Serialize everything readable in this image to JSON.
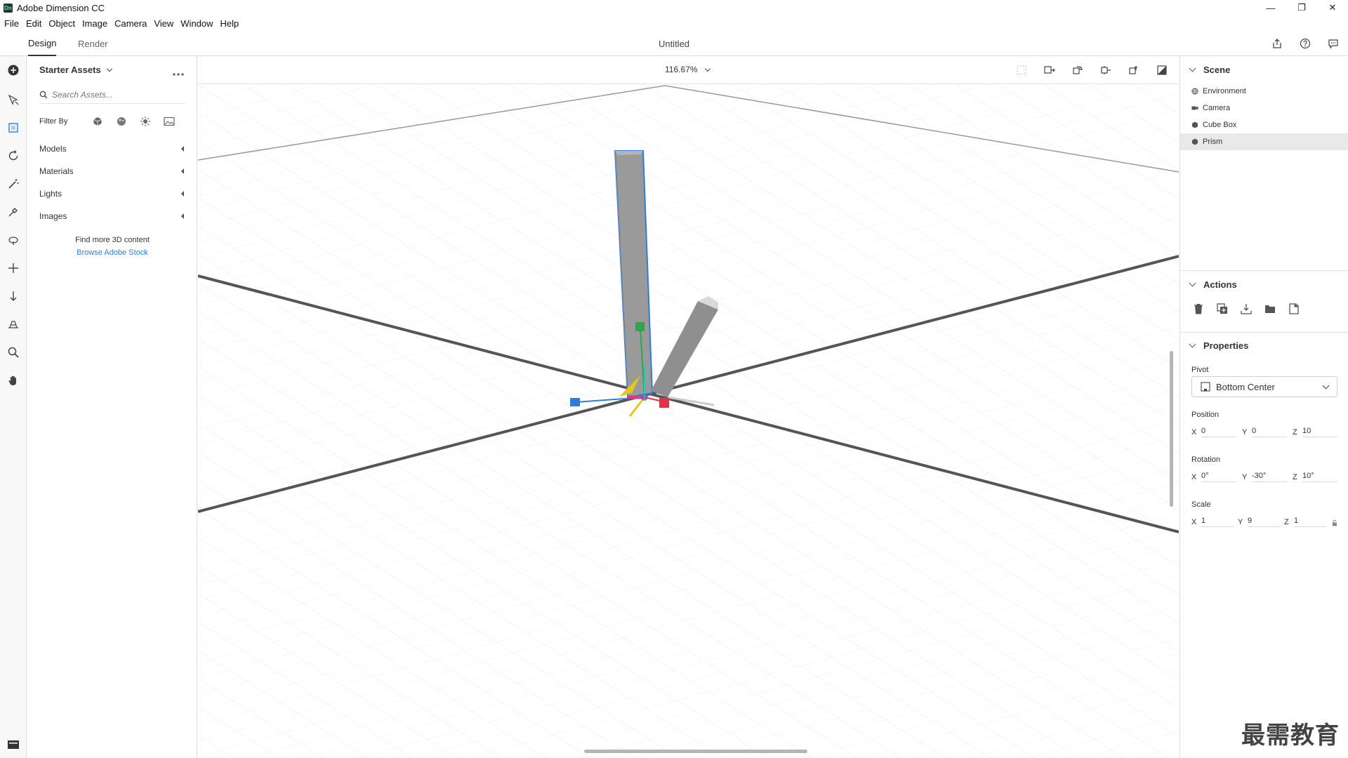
{
  "window": {
    "app_title": "Adobe Dimension CC",
    "app_icon_text": "Dn",
    "minimize": "—",
    "restore": "❐",
    "close": "✕"
  },
  "menu": [
    "File",
    "Edit",
    "Object",
    "Image",
    "Camera",
    "View",
    "Window",
    "Help"
  ],
  "workspace": {
    "tabs": [
      "Design",
      "Render"
    ],
    "active_tab": "Design",
    "doc_title": "Untitled"
  },
  "assets": {
    "header": "Starter Assets",
    "search_placeholder": "Search Assets...",
    "filter_label": "Filter By",
    "categories": [
      "Models",
      "Materials",
      "Lights",
      "Images"
    ],
    "more_text": "Find more 3D content",
    "more_link": "Browse Adobe Stock"
  },
  "viewport": {
    "zoom": "116.67%"
  },
  "scene": {
    "title": "Scene",
    "items": [
      {
        "label": "Environment",
        "icon": "environment-icon"
      },
      {
        "label": "Camera",
        "icon": "camera-icon"
      },
      {
        "label": "Cube Box",
        "icon": "model-icon"
      },
      {
        "label": "Prism",
        "icon": "model-icon",
        "selected": true
      }
    ]
  },
  "actions": {
    "title": "Actions",
    "icons": [
      "delete-icon",
      "duplicate-icon",
      "drop-to-ground-icon",
      "group-icon",
      "save-icon"
    ]
  },
  "properties": {
    "title": "Properties",
    "pivot_label": "Pivot",
    "pivot_value": "Bottom Center",
    "position_label": "Position",
    "position": {
      "x": "0",
      "y": "0",
      "z": "10"
    },
    "rotation_label": "Rotation",
    "rotation": {
      "x": "0°",
      "y": "-30°",
      "z": "10°"
    },
    "scale_label": "Scale",
    "scale": {
      "x": "1",
      "y": "9",
      "z": "1"
    }
  },
  "axis_labels": {
    "x": "X",
    "y": "Y",
    "z": "Z"
  },
  "watermark": "最需教育",
  "colors": {
    "selection": "#2d7ed8",
    "gizmo_x": "#e0334a",
    "gizmo_y": "#2ba84a",
    "gizmo_z": "#2d7ed8"
  }
}
